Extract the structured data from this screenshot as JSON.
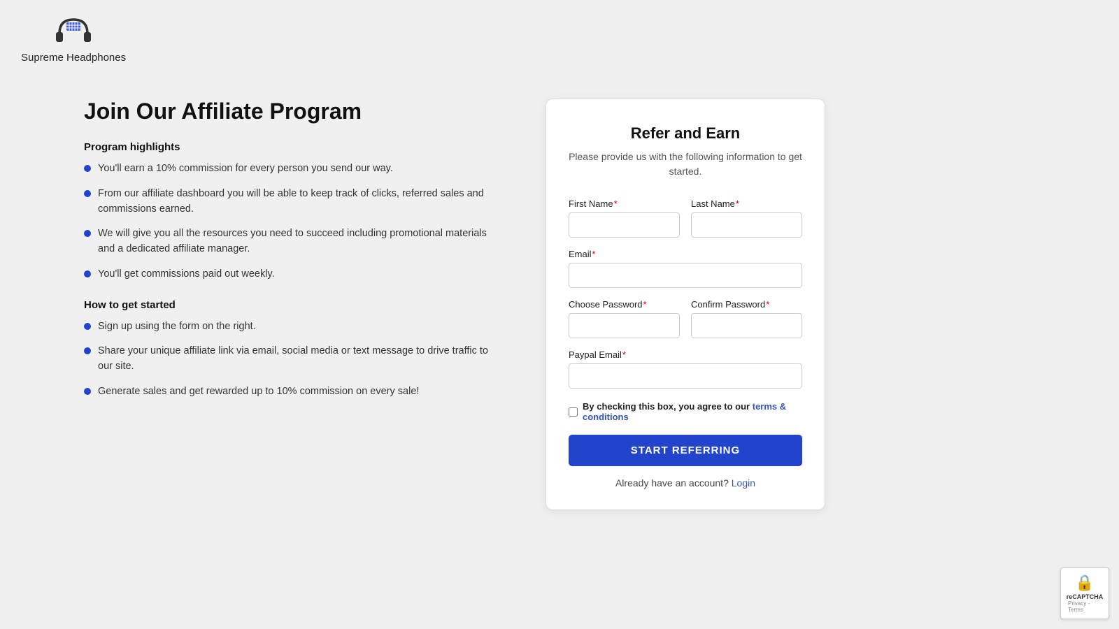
{
  "header": {
    "logo_alt": "Supreme Headphones Logo",
    "brand_name": "Supreme Headphones"
  },
  "left": {
    "title": "Join Our Affiliate Program",
    "highlights_heading": "Program highlights",
    "highlights": [
      "You'll earn a 10% commission for every person you send our way.",
      "From our affiliate dashboard you will be able to keep track of clicks, referred sales and commissions earned.",
      "We will give you all the resources you need to succeed including promotional materials and a dedicated affiliate manager.",
      "You'll get commissions paid out weekly."
    ],
    "how_heading": "How to get started",
    "how_items": [
      "Sign up using the form on the right.",
      "Share your unique affiliate link via email, social media or text message to drive traffic to our site.",
      "Generate sales and get rewarded up to 10% commission on every sale!"
    ]
  },
  "form": {
    "title": "Refer and Earn",
    "subtitle": "Please provide us with the following information to get started.",
    "first_name_label": "First Name",
    "last_name_label": "Last Name",
    "email_label": "Email",
    "password_label": "Choose Password",
    "confirm_password_label": "Confirm Password",
    "paypal_email_label": "Paypal Email",
    "terms_text": "By checking this box, you agree to our",
    "terms_link_text": "terms & conditions",
    "submit_label": "START REFERRING",
    "login_text": "Already have an account?",
    "login_link": "Login"
  },
  "recaptcha": {
    "label": "reCAPTCHA",
    "privacy": "Privacy - Terms"
  }
}
